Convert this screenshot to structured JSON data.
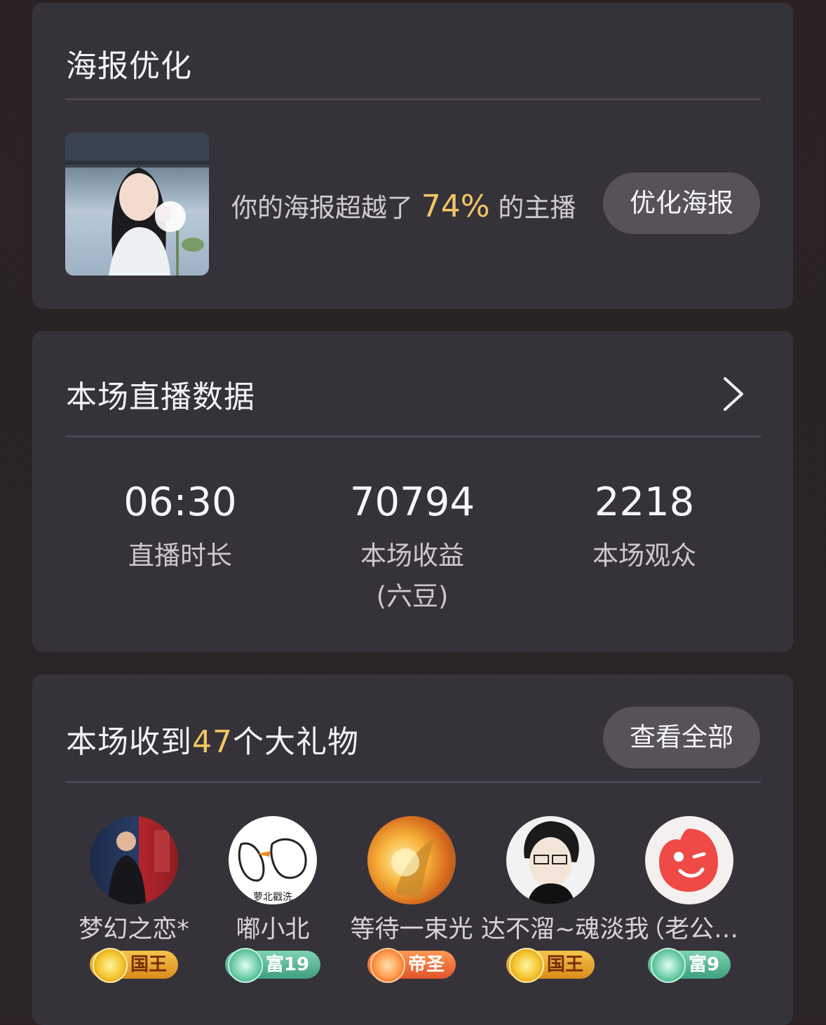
{
  "poster_card": {
    "title": "海报优化",
    "text_before": "你的海报超越了",
    "percent": "74%",
    "text_after": "的主播",
    "button_label": "优化海报"
  },
  "stats_card": {
    "title": "本场直播数据",
    "stats": [
      {
        "value": "06:30",
        "label": "直播时长"
      },
      {
        "value": "70794",
        "label": "本场收益\n(六豆)"
      },
      {
        "value": "2218",
        "label": "本场观众"
      }
    ]
  },
  "gifts_card": {
    "title_before": "本场收到",
    "count": "47",
    "title_after": "个大礼物",
    "button_label": "查看全部",
    "gifters": [
      {
        "name": "梦幻之恋*",
        "badge": "国王",
        "badge_color": "gold"
      },
      {
        "name": "嘟小北",
        "badge": "富19",
        "badge_color": "green"
      },
      {
        "name": "等待一束光",
        "badge": "帝圣",
        "badge_color": "orange"
      },
      {
        "name": "达不溜~魂淡我",
        "badge": "国王",
        "badge_color": "gold"
      },
      {
        "name": "（老公…",
        "badge": "富9",
        "badge_color": "green"
      }
    ]
  },
  "colors": {
    "card_bg": "#363239",
    "accent_gold": "#f2c763",
    "pill_bg": "#575259"
  }
}
